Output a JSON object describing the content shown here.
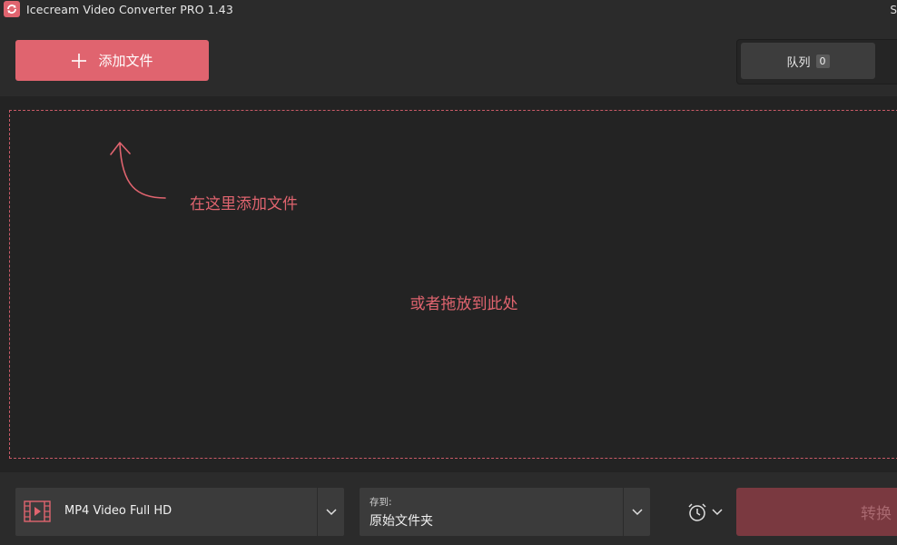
{
  "window": {
    "title": "Icecream Video Converter PRO 1.43",
    "edge_glyph": "S"
  },
  "toolbar": {
    "add_files_label": "添加文件",
    "queue_label": "队列",
    "queue_count": "0"
  },
  "dropzone": {
    "hint": "在这里添加文件",
    "drop_text": "或者拖放到此处"
  },
  "bottom": {
    "format_value": "MP4 Video Full HD",
    "save_caption": "存到:",
    "save_value": "原始文件夹",
    "convert_label": "转换"
  },
  "colors": {
    "accent": "#e0646f",
    "background": "#2b2b2b",
    "dropzone_bg": "#232323",
    "convert_disabled": "#7a3940"
  },
  "icons": [
    "app-logo-icon",
    "plus-icon",
    "curved-arrow-icon",
    "film-icon",
    "chevron-down-icon",
    "alarm-clock-icon"
  ]
}
